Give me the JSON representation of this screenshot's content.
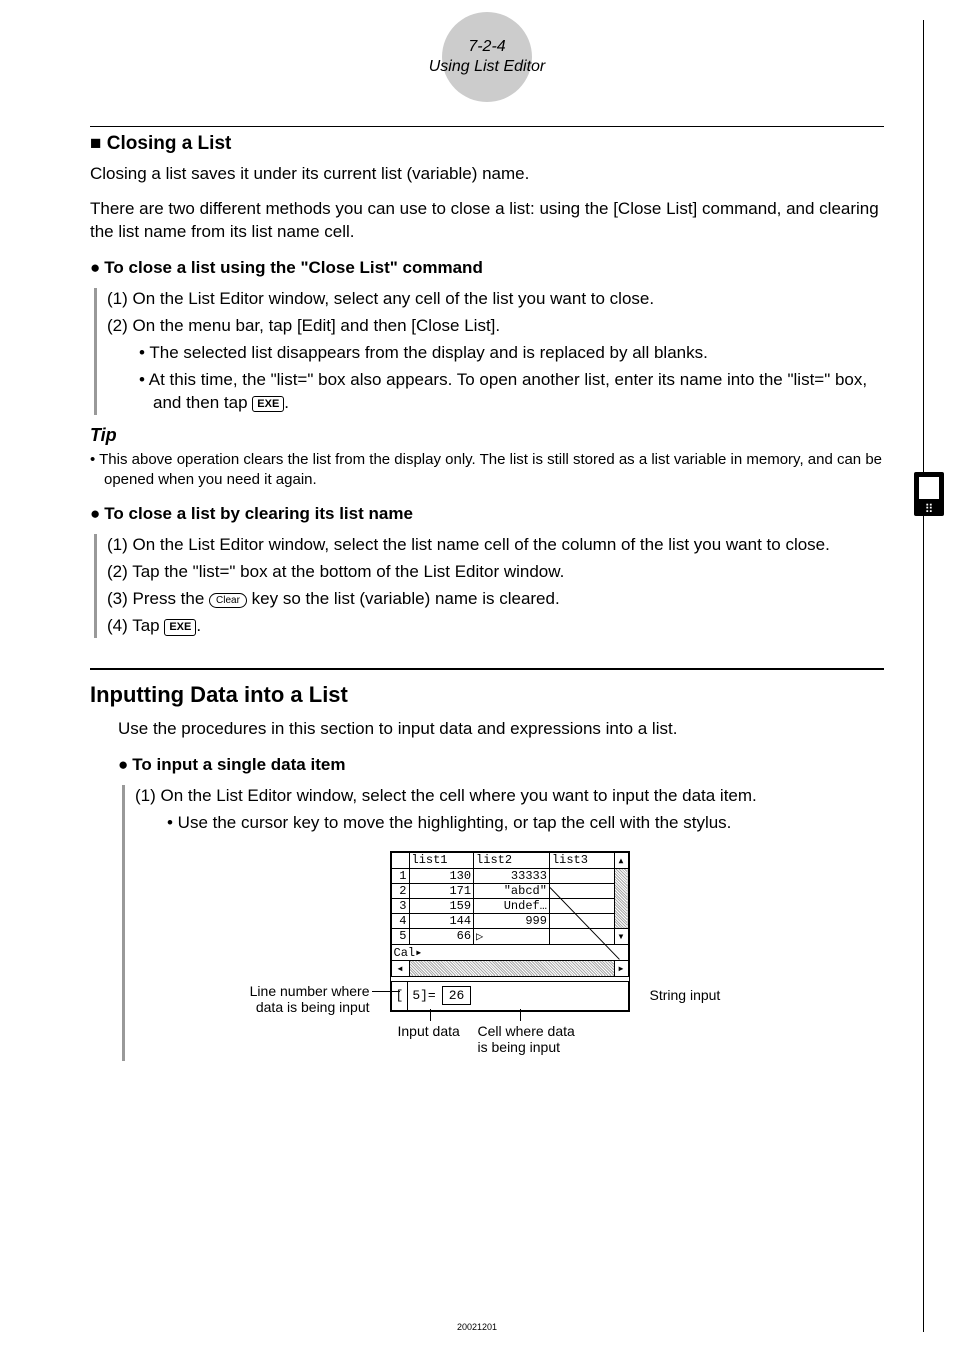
{
  "header": {
    "chapter": "7-2-4",
    "title": "Using List Editor"
  },
  "section1": {
    "square": "■",
    "heading": "Closing a List",
    "p1": "Closing a list saves it under its current list (variable) name.",
    "p2": "There are two different methods you can use to close a list: using the [Close List] command, and clearing the list name from its list name cell."
  },
  "bulletA": {
    "dot": "●",
    "heading": "To close a list using the \"Close List\" command",
    "step1": "(1) On the List Editor window, select any cell of the list you want to close.",
    "step2": "(2) On the menu bar, tap [Edit] and then [Close List].",
    "sub1": "• The selected list disappears from the display and is replaced by all blanks.",
    "sub2a": "• At this time, the \"list=\" box also appears. To open another list, enter its name into the \"list=\" box, and then tap ",
    "sub2b": "."
  },
  "tip": {
    "head": "Tip",
    "body": "• This above operation clears the list from the display only. The list is still stored as a list variable in memory, and can be opened when you need it again."
  },
  "bulletB": {
    "dot": "●",
    "heading": "To close a list by clearing its list name",
    "step1": "(1) On the List Editor window, select the list name cell of the column of the list you want to close.",
    "step2": "(2) Tap the \"list=\" box at the bottom of the List Editor window.",
    "step3a": "(3) Press the ",
    "step3b": " key so the list (variable) name is cleared.",
    "step4a": "(4) Tap ",
    "step4b": "."
  },
  "section2": {
    "heading": "Inputting Data into a List",
    "p1": "Use the procedures in this section to input data and expressions into a list."
  },
  "bulletC": {
    "dot": "●",
    "heading": "To input a single data item",
    "step1": "(1) On the List Editor window, select the cell where you want to input the data item.",
    "sub1": "• Use the cursor key to move the highlighting, or tap the cell with the stylus."
  },
  "keys": {
    "exe": "EXE",
    "clear": "Clear"
  },
  "diagram": {
    "headers": [
      "list1",
      "list2",
      "list3"
    ],
    "rows": [
      [
        "1",
        "130",
        "33333",
        ""
      ],
      [
        "2",
        "171",
        "\"abcd\"",
        ""
      ],
      [
        "3",
        "159",
        "Undef…",
        ""
      ],
      [
        "4",
        "144",
        "999",
        ""
      ],
      [
        "5",
        "66",
        "▷",
        ""
      ]
    ],
    "cal": "Cal▸",
    "inputLabel": "[",
    "inputEq": "5]=",
    "inputVal": "26",
    "calloutLeft1": "Line number where",
    "calloutLeft2": "data is being input",
    "calloutRight": "String input",
    "calloutBottom1": "Input data",
    "calloutBottom2a": "Cell where data",
    "calloutBottom2b": "is being input"
  },
  "footer": "20021201"
}
